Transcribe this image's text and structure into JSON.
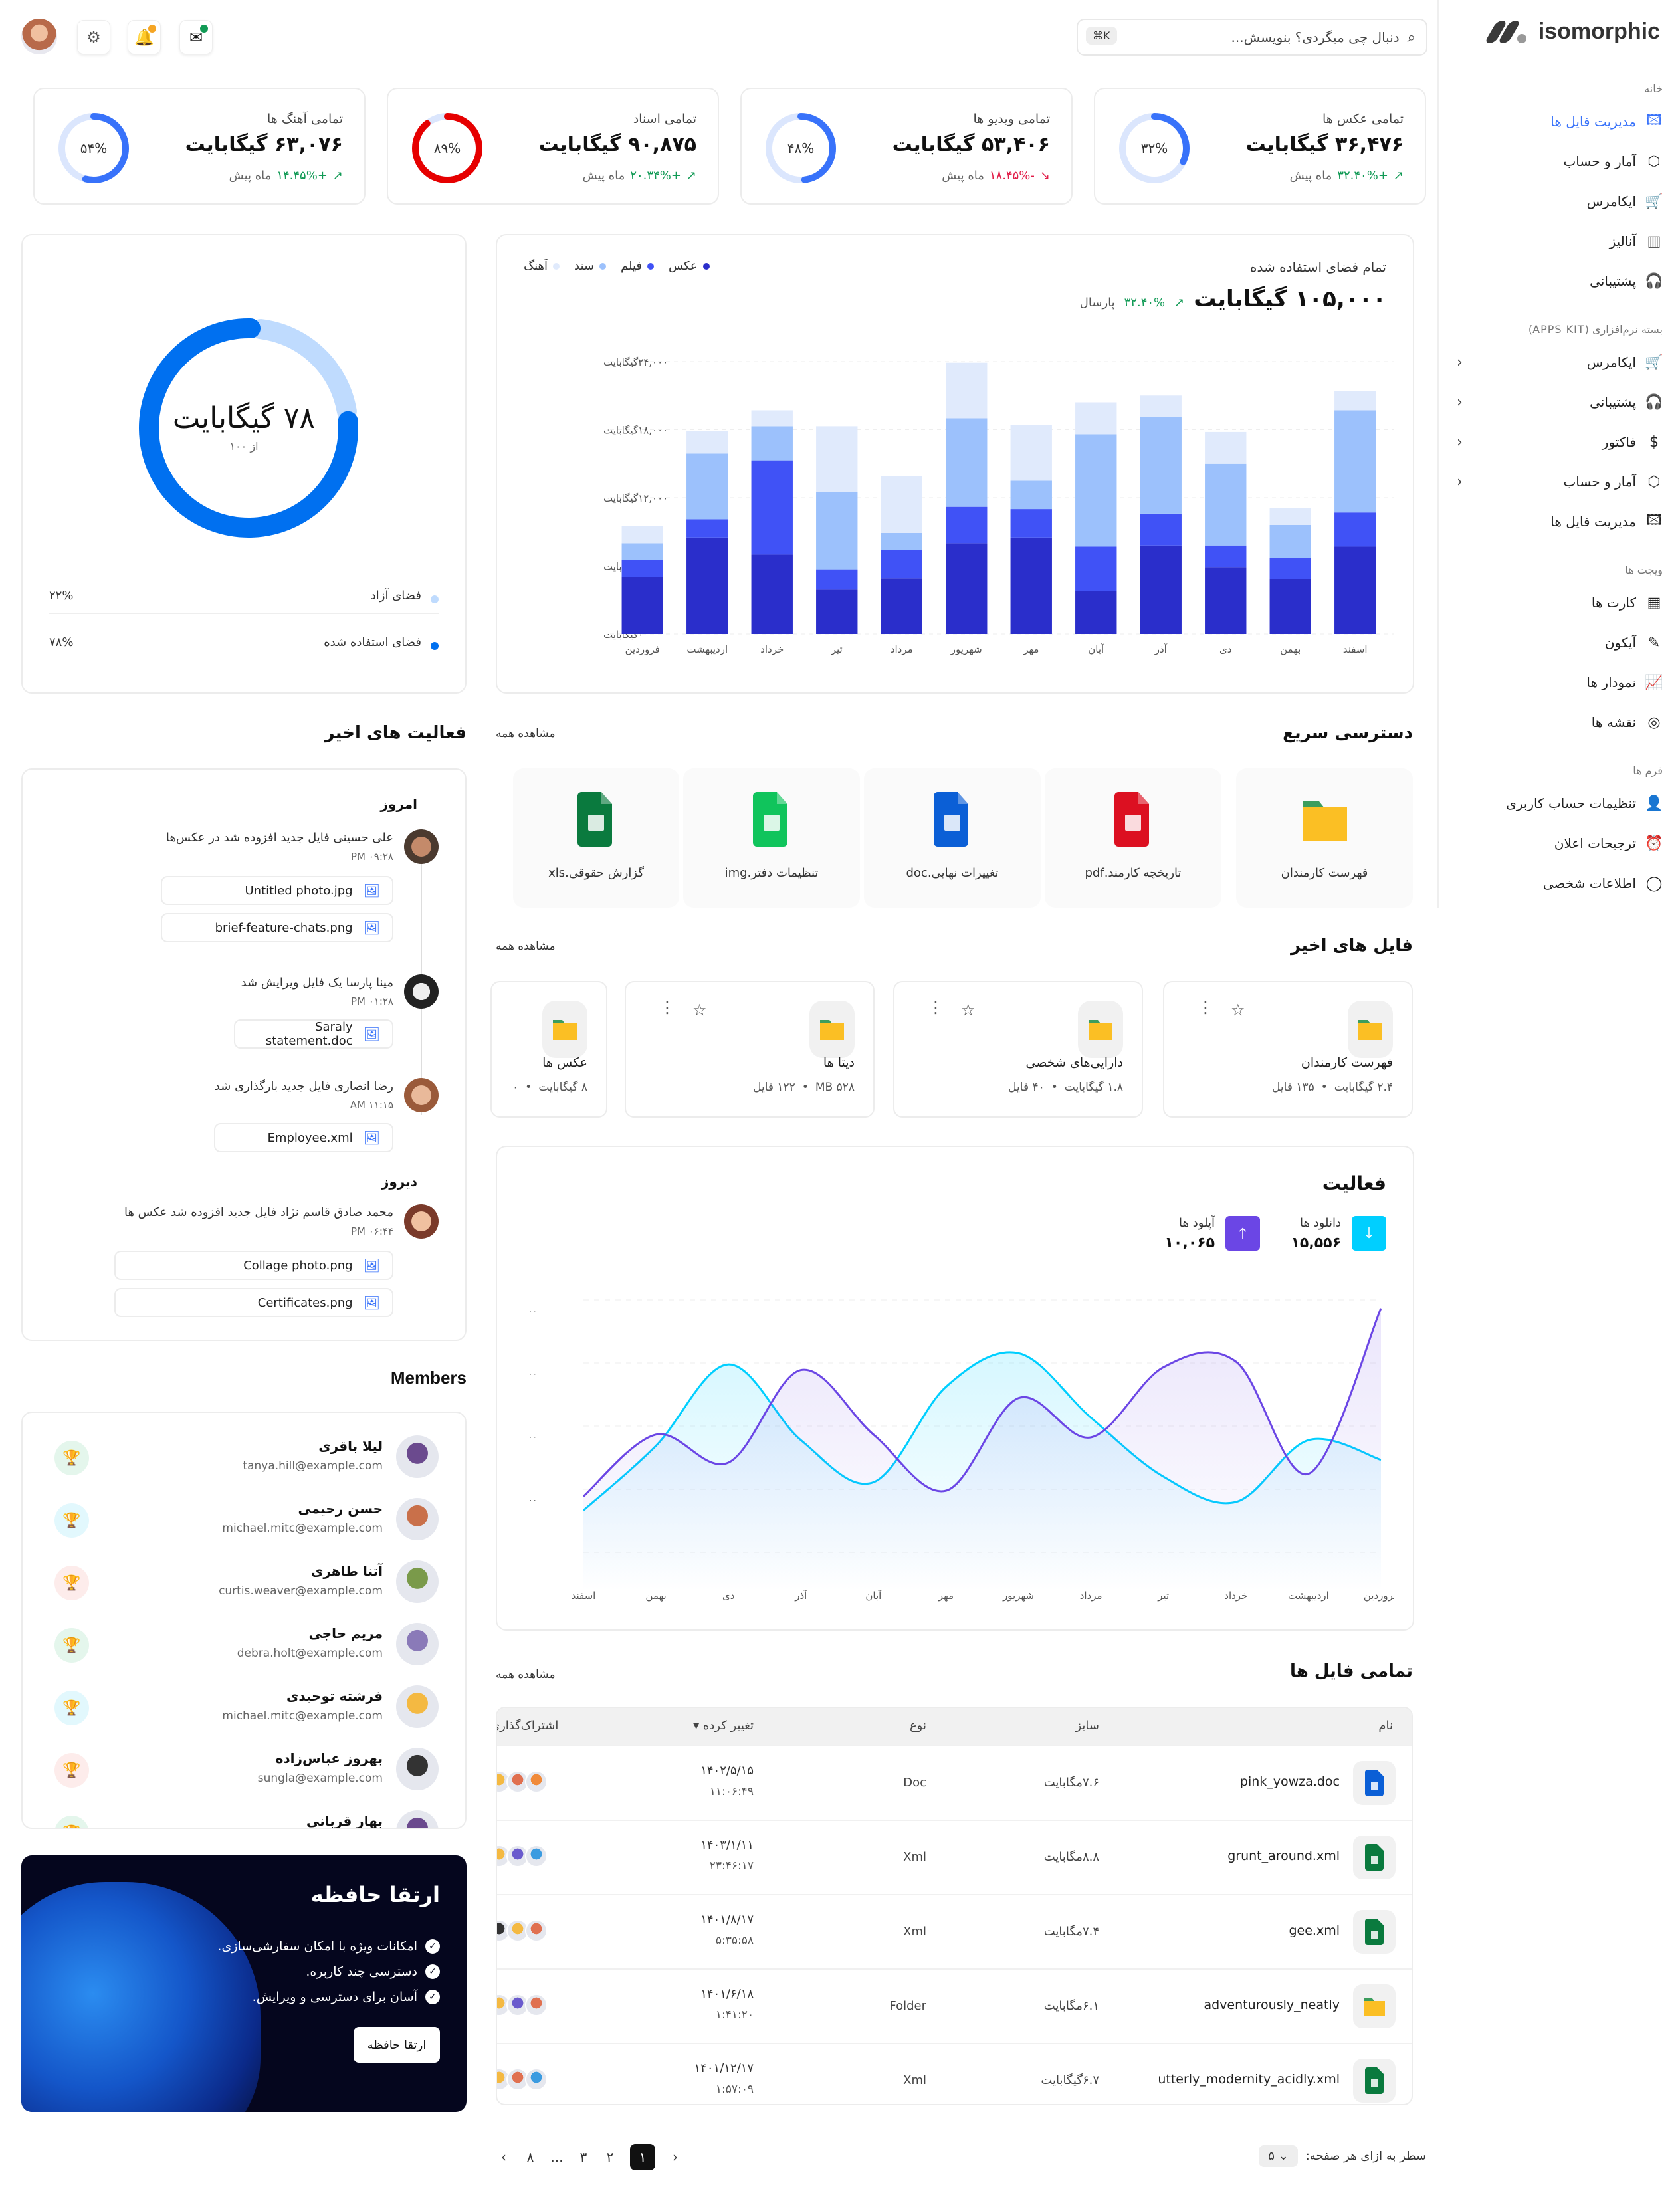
{
  "sidebar": {
    "brand": "isomorphic",
    "sections": [
      {
        "title": "خانه",
        "items": [
          {
            "label": "مدیریت فایل ها",
            "icon": "image-file-icon",
            "active": true
          },
          {
            "label": "آمار و حساب",
            "icon": "box-icon"
          },
          {
            "label": "ایکامرس",
            "icon": "cart-icon"
          },
          {
            "label": "آنالیز",
            "icon": "bar-chart-icon"
          },
          {
            "label": "پشتیبانی",
            "icon": "headset-icon"
          }
        ]
      },
      {
        "title": "بسته نرم‌افزاری (APPS KIT)",
        "items": [
          {
            "label": "ایکامرس",
            "icon": "cart-icon",
            "expandable": true
          },
          {
            "label": "پشتیبانی",
            "icon": "headset-icon",
            "expandable": true
          },
          {
            "label": "فاکتور",
            "icon": "dollar-icon",
            "expandable": true
          },
          {
            "label": "آمار و حساب",
            "icon": "box-icon",
            "expandable": true
          },
          {
            "label": "مدیریت فایل ها",
            "icon": "image-file-icon"
          }
        ]
      },
      {
        "title": "ویجت ها",
        "items": [
          {
            "label": "کارت ها",
            "icon": "grid-icon"
          },
          {
            "label": "آیکون",
            "icon": "feather-icon"
          },
          {
            "label": "نمودار ها",
            "icon": "line-chart-icon"
          },
          {
            "label": "نقشه ها",
            "icon": "map-pin-icon"
          }
        ]
      },
      {
        "title": "فرم ها",
        "items": [
          {
            "label": "تنظیمات حساب کاربری",
            "icon": "user-settings-icon"
          },
          {
            "label": "ترجیحات اعلان",
            "icon": "alarm-icon"
          },
          {
            "label": "اطلاعات شخصی",
            "icon": "user-icon"
          }
        ]
      }
    ]
  },
  "header": {
    "search_placeholder": "دنبال چی میگردی؟ بنویسش...",
    "shortcut": "⌘K",
    "icons": [
      "messages-icon",
      "bell-icon",
      "settings-icon",
      "avatar"
    ]
  },
  "stats": [
    {
      "title": "تمامی عکس ها",
      "value": "۳۶,۴۷۶ گیگابایت",
      "change": "+۳۲.۴۰%",
      "trend": "up",
      "suffix": "ماه پیش",
      "percent": 32,
      "percent_label": "۳۲%",
      "color": "#3872fa"
    },
    {
      "title": "تمامی ویدیو ها",
      "value": "۵۳,۴۰۶ گیگابایت",
      "change": "-۱۸.۴۵%",
      "trend": "down",
      "suffix": "ماه پیش",
      "percent": 48,
      "percent_label": "۴۸%",
      "color": "#3872fa"
    },
    {
      "title": "تمامی اسناد",
      "value": "۹۰,۸۷۵ گیگابایت",
      "change": "+۲۰.۳۴%",
      "trend": "up",
      "suffix": "ماه پیش",
      "percent": 89,
      "percent_label": "۸۹%",
      "color": "#e60000"
    },
    {
      "title": "تمامی آهنگ ها",
      "value": "۶۳,۰۷۶ گیگابایت",
      "change": "+۱۴.۴۵%",
      "trend": "up",
      "suffix": "ماه پیش",
      "percent": 54,
      "percent_label": "۵۴%",
      "color": "#3872fa"
    }
  ],
  "storage_chart": {
    "title": "تمام فضای استفاده شده",
    "total": "۱۰۵,۰۰۰ گیگابایت",
    "change": "۳۲.۴۰%",
    "change_suffix": "پارسال"
  },
  "chart_data": [
    {
      "type": "bar",
      "stacked": true,
      "title": "تمام فضای استفاده شده",
      "categories": [
        "فروردین",
        "اردیبهشت",
        "خرداد",
        "تیر",
        "مرداد",
        "شهریور",
        "مهر",
        "آبان",
        "آذر",
        "دی",
        "بهمن",
        "اسفند"
      ],
      "series": [
        {
          "name": "عکس",
          "color": "#2a2ecb",
          "values": [
            5000,
            8500,
            7000,
            3900,
            4900,
            8000,
            8500,
            3800,
            7800,
            5900,
            4800,
            7700
          ]
        },
        {
          "name": "فیلم",
          "color": "#4052f6",
          "values": [
            1500,
            1600,
            8300,
            1800,
            2500,
            3200,
            2500,
            3900,
            2800,
            1900,
            1900,
            3000
          ]
        },
        {
          "name": "سند",
          "color": "#9cc1fc",
          "values": [
            1500,
            5800,
            3000,
            6800,
            1500,
            7800,
            2500,
            9900,
            8500,
            7200,
            2900,
            9000
          ]
        },
        {
          "name": "آهنگ",
          "color": "#e0eafc",
          "values": [
            1500,
            2000,
            1400,
            5800,
            5000,
            4900,
            4900,
            2800,
            1900,
            2800,
            1500,
            1700
          ]
        }
      ],
      "yticks": [
        "۰گیگابایت",
        "۶,۰۰۰گیگابایت",
        "۱۲,۰۰۰گیگابایت",
        "۱۸,۰۰۰گیگابایت",
        "۲۴,۰۰۰گیگابایت"
      ],
      "ylim": [
        0,
        24000
      ],
      "legend": "top-left",
      "grid": true
    },
    {
      "type": "pie",
      "title": "۷۸ گیگابایت",
      "subtitle": "از ۱۰۰",
      "slices": [
        {
          "name": "فضای آزاد",
          "value": 22,
          "label": "۲۲%",
          "color": "#bfdbfe"
        },
        {
          "name": "فضای استفاده شده",
          "value": 78,
          "label": "۷۸%",
          "color": "#0070f0"
        }
      ]
    },
    {
      "type": "area",
      "title": "فعالیت",
      "categories": [
        "فروردین",
        "اردیبهشت",
        "خرداد",
        "تیر",
        "مرداد",
        "شهریور",
        "مهر",
        "آبان",
        "آذر",
        "دی",
        "بهمن",
        "اسفند"
      ],
      "series": [
        {
          "name": "دانلود ها",
          "color": "#00cfff",
          "values": [
            1500,
            3800,
            6700,
            4000,
            2500,
            5900,
            7100,
            4800,
            2700,
            1800,
            4000,
            3300
          ]
        },
        {
          "name": "آپلود ها",
          "color": "#6b46e5",
          "values": [
            2000,
            4200,
            3200,
            6500,
            4200,
            2200,
            5500,
            4100,
            6600,
            6800,
            2800,
            8700
          ]
        }
      ],
      "ylim": [
        0,
        9000
      ],
      "grid": true
    }
  ],
  "donut_card": {
    "center_value": "۷۸ گیگابایت",
    "center_sub": "از ۱۰۰",
    "legend": [
      {
        "label": "فضای آزاد",
        "value": "۲۲%",
        "color": "#bfdbfe"
      },
      {
        "label": "فضای استفاده شده",
        "value": "۷۸%",
        "color": "#0070f0"
      }
    ]
  },
  "quick_access": {
    "title": "دسترسی سریع",
    "see_all": "مشاهده همه",
    "items": [
      {
        "label": "فهرست کارمندان",
        "icon": "folder-icon"
      },
      {
        "label": "تاریخچه کارمند.pdf",
        "icon": "pdf-file-icon"
      },
      {
        "label": "تغییرات نهایی.doc",
        "icon": "doc-file-icon"
      },
      {
        "label": "تنظیمات دفتر.img",
        "icon": "image-file-icon"
      },
      {
        "label": "گزارش حقوقی.xls",
        "icon": "sheet-file-icon"
      }
    ]
  },
  "recent_activity": {
    "title": "فعالیت های اخیر",
    "groups": [
      {
        "day": "امروز",
        "entries": [
          {
            "text": "علی حسینی فایل جدید افزوده شد در عکس‌ها",
            "time": "PM ۰۹:۲۸",
            "files": [
              "Untitled photo.jpg",
              "brief-feature-chats.png"
            ]
          },
          {
            "text": "مینا پارسا یک فایل ویرایش شد",
            "time": "PM ۰۱:۲۸",
            "files": [
              "Saraly statement.doc"
            ]
          },
          {
            "text": "رضا انصاری فایل جدید بارگذاری شد",
            "time": "AM ۱۱:۱۵",
            "files": [
              "Employee.xml"
            ]
          }
        ]
      },
      {
        "day": "دیروز",
        "entries": [
          {
            "text": "محمد صادق قاسم نژاد فایل جدید افزوده شد عکس ها",
            "time": "PM ۰۶:۴۴",
            "files": [
              "Collage photo.png",
              "Certificates.png"
            ]
          }
        ]
      }
    ]
  },
  "recent_files": {
    "title": "فایل های اخیر",
    "see_all": "مشاهده همه",
    "items": [
      {
        "name": "فهرست کارمندان",
        "size": "۲.۴ گیگابایت",
        "count": "۱۳۵ فایل"
      },
      {
        "name": "دارایی‌های شخصی",
        "size": "۱.۸ گیگابایت",
        "count": "۴۰ فایل"
      },
      {
        "name": "دیتا ها",
        "size": "MB ۵۲۸",
        "count": "۱۲۲ فایل"
      },
      {
        "name": "عکس ها",
        "size": "۸ گیگابایت",
        "count": "۰"
      }
    ]
  },
  "activity": {
    "title": "فعالیت",
    "downloads_label": "دانلود ها",
    "downloads_value": "۱۵,۵۵۶",
    "uploads_label": "آپلود ها",
    "uploads_value": "۱۰,۰۶۵",
    "yticks": [
      "۰۰",
      "۰۰",
      "۰۰",
      "۰۰"
    ]
  },
  "members": {
    "title": "Members",
    "items": [
      {
        "name": "لیلا باقری",
        "email": "tanya.hill@example.com",
        "trophy": "green"
      },
      {
        "name": "حسن رحیمی",
        "email": "michael.mitc@example.com",
        "trophy": "cyan"
      },
      {
        "name": "آتنا طاهری",
        "email": "curtis.weaver@example.com",
        "trophy": "red"
      },
      {
        "name": "مریم حاجی",
        "email": "debra.holt@example.com",
        "trophy": "green"
      },
      {
        "name": "فرشته توحیدی",
        "email": "michael.mitc@example.com",
        "trophy": "cyan"
      },
      {
        "name": "بهروز عباس‌زاده",
        "email": "sungla@example.com",
        "trophy": "red"
      },
      {
        "name": "بهار قربانی",
        "email": "",
        "trophy": "green"
      }
    ]
  },
  "upgrade": {
    "title": "ارتقا حافظه",
    "features": [
      "امکانات ویژه با امکان سفارشی‌سازی.",
      "دسترسی چند کاربره.",
      "آسان برای دسترسی و ویرایش."
    ],
    "button": "ارتقا حافظه"
  },
  "all_files": {
    "title": "تمامی فایل ها",
    "see_all": "مشاهده همه",
    "columns": [
      "نام",
      "سایز",
      "نوع",
      "تغییر کرده ▾",
      "اشتراک‌گذاری"
    ],
    "rows": [
      {
        "name": "pink_yowza.doc",
        "icon": "doc",
        "size": "۷.۶مگابایت",
        "type": "Doc",
        "date": "۱۴۰۲/۵/۱۵",
        "time": "۱۱:۰۶:۴۹"
      },
      {
        "name": "grunt_around.xml",
        "icon": "sheet",
        "size": "۸.۸مگابایت",
        "type": "Xml",
        "date": "۱۴۰۳/۱/۱۱",
        "time": "۲۳:۴۶:۱۷"
      },
      {
        "name": "gee.xml",
        "icon": "sheet",
        "size": "۷.۴مگابایت",
        "type": "Xml",
        "date": "۱۴۰۱/۸/۱۷",
        "time": "۵:۳۵:۵۸"
      },
      {
        "name": "adventurously_neatly",
        "icon": "folder",
        "size": "۶.۱مگابایت",
        "type": "Folder",
        "date": "۱۴۰۱/۶/۱۸",
        "time": "۱:۴۱:۲۰"
      },
      {
        "name": "utterly_modernity_acidly.xml",
        "icon": "sheet",
        "size": "۶.۷گیگابایت",
        "type": "Xml",
        "date": "۱۴۰۱/۱۲/۱۷",
        "time": "۱:۵۷:۰۹"
      }
    ]
  },
  "pagination": {
    "rows_label": "سطر به ازای هر صفحه:",
    "rows_value": "۵",
    "pages": [
      "۱",
      "۲",
      "۳",
      "...",
      "۸"
    ],
    "current": "۱"
  }
}
